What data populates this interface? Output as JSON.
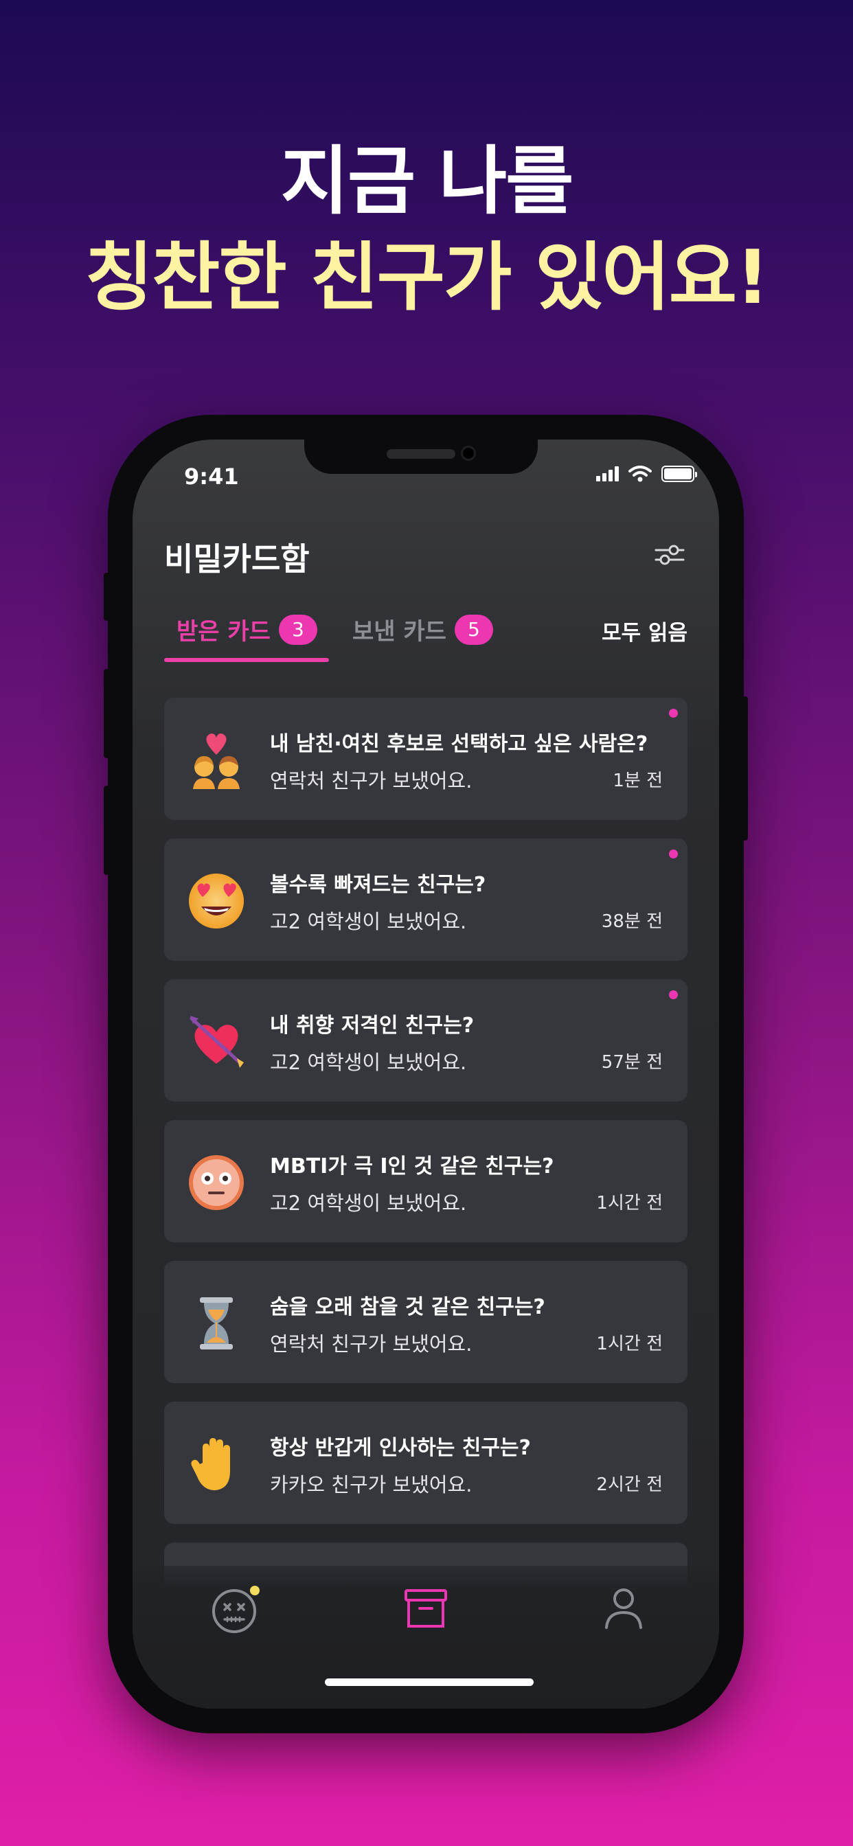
{
  "headline": {
    "line1": "지금 나를",
    "line2": "칭찬한 친구가 있어요!"
  },
  "status_bar": {
    "time": "9:41"
  },
  "header": {
    "title": "비밀카드함",
    "filter_icon": "sliders-icon"
  },
  "tabs": {
    "received": {
      "label": "받은 카드",
      "count": "3"
    },
    "sent": {
      "label": "보낸 카드",
      "count": "5"
    },
    "mark_all_read": "모두 읽음"
  },
  "cards": [
    {
      "icon": "kissing-couple-emoji",
      "question": "내 남친·여친 후보로 선택하고 싶은 사람은?",
      "from": "연락처 친구가 보냈어요.",
      "time": "1분 전",
      "unread": true
    },
    {
      "icon": "heart-eyes-emoji",
      "question": "볼수록 빠져드는 친구는?",
      "from": "고2 여학생이 보냈어요.",
      "time": "38분 전",
      "unread": true
    },
    {
      "icon": "heart-arrow-emoji",
      "question": "내 취향 저격인 친구는?",
      "from": "고2 여학생이 보냈어요.",
      "time": "57분 전",
      "unread": true
    },
    {
      "icon": "neutral-face-emoji",
      "question": "MBTI가 극 I인 것 같은 친구는?",
      "from": "고2 여학생이 보냈어요.",
      "time": "1시간 전",
      "unread": false
    },
    {
      "icon": "hourglass-emoji",
      "question": "숨을 오래 참을 것 같은 친구는?",
      "from": "연락처 친구가 보냈어요.",
      "time": "1시간 전",
      "unread": false
    },
    {
      "icon": "raised-hand-emoji",
      "question": "항상 반갑게 인사하는 친구는?",
      "from": "카카오 친구가 보냈어요.",
      "time": "2시간 전",
      "unread": false
    }
  ],
  "tabbar": {
    "items": [
      {
        "icon": "dizzy-face-icon",
        "active": false,
        "has_notification": true
      },
      {
        "icon": "archive-box-icon",
        "active": true
      },
      {
        "icon": "profile-icon",
        "active": false
      }
    ]
  },
  "colors": {
    "accent": "#ec37b0",
    "headline_highlight": "#fff3a3",
    "card_bg": "#36373c",
    "notification_dot": "#f4dd5c"
  }
}
